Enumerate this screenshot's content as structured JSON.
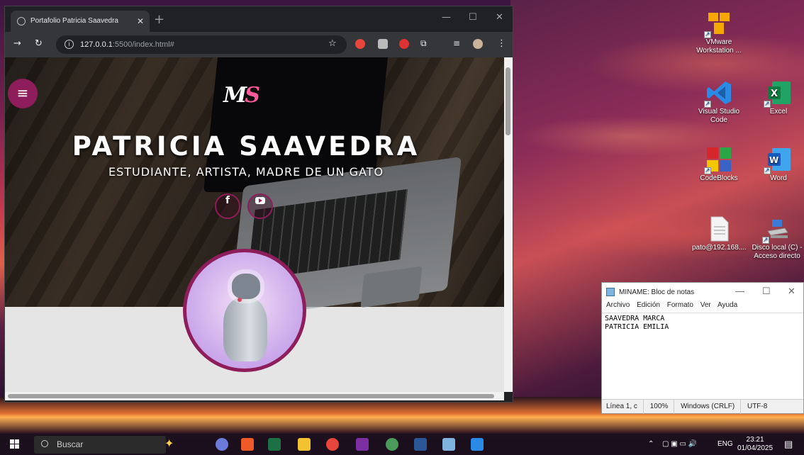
{
  "desktop": {
    "icons": [
      {
        "label": "VMware Workstation ...",
        "color": "#f5a800"
      },
      {
        "label": "Visual Studio Code",
        "color": "#2a8ae6"
      },
      {
        "label": "Excel",
        "color": "#1d7044"
      },
      {
        "label": "CodeBlocks",
        "color": "#d7262b"
      },
      {
        "label": "Word",
        "color": "#2b5797"
      },
      {
        "label": "pato@192.168....",
        "color": "#ffffff"
      },
      {
        "label": "Disco local (C) - Acceso directo",
        "color": "#3a7bd5"
      }
    ]
  },
  "browser": {
    "tab_title": "Portafolio Patricia Saavedra",
    "url_host": "127.0.0.1",
    "url_path": ":5500/index.html#",
    "info_icon": "i"
  },
  "page": {
    "logo_left": "M",
    "logo_right": "S",
    "title": "PATRICIA SAAVEDRA",
    "subtitle": "ESTUDIANTE, ARTISTA, MADRE DE UN GATO",
    "social": {
      "facebook": "f"
    },
    "accent": "#8e1d5b"
  },
  "notepad": {
    "title": "MINAME: Bloc de notas",
    "menu": [
      "Archivo",
      "Edición",
      "Formato",
      "Ver",
      "Ayuda"
    ],
    "lines": [
      "SAAVEDRA MARCA",
      "PATRICIA EMILIA"
    ],
    "status": {
      "position": "Línea 1, c",
      "zoom": "100%",
      "eol": "Windows (CRLF)",
      "encoding": "UTF-8"
    }
  },
  "taskbar": {
    "search_placeholder": "Buscar",
    "language": "ENG",
    "time": "23:21",
    "date": "01/04/2025"
  }
}
